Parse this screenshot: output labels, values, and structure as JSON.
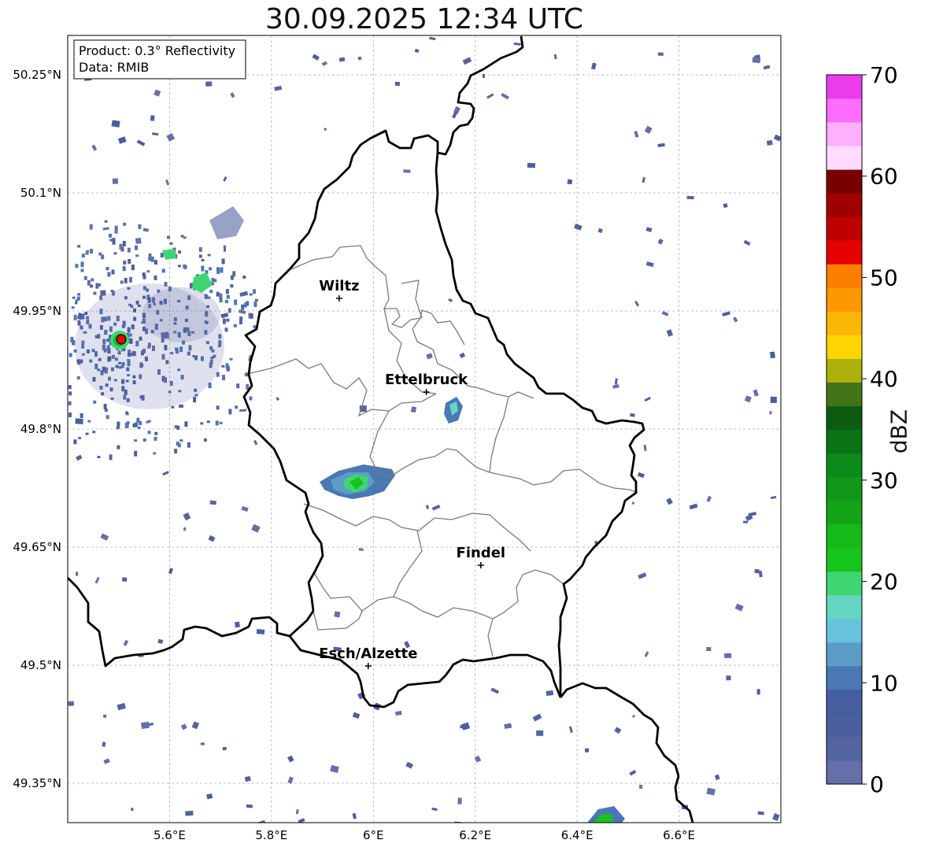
{
  "title": "30.09.2025 12:34 UTC",
  "info_box": {
    "product": "Product: 0.3° Reflectivity",
    "data": "Data: RMIB"
  },
  "map": {
    "lon_ticks": [
      {
        "value": 5.6,
        "label": "5.6°E"
      },
      {
        "value": 5.8,
        "label": "5.8°E"
      },
      {
        "value": 6.0,
        "label": "6°E"
      },
      {
        "value": 6.2,
        "label": "6.2°E"
      },
      {
        "value": 6.4,
        "label": "6.4°E"
      },
      {
        "value": 6.6,
        "label": "6.6°E"
      }
    ],
    "lat_ticks": [
      {
        "value": 50.25,
        "label": "50.25°N"
      },
      {
        "value": 50.1,
        "label": "50.1°N"
      },
      {
        "value": 49.95,
        "label": "49.95°N"
      },
      {
        "value": 49.8,
        "label": "49.8°N"
      },
      {
        "value": 49.65,
        "label": "49.65°N"
      },
      {
        "value": 49.5,
        "label": "49.5°N"
      },
      {
        "value": 49.35,
        "label": "49.35°N"
      }
    ],
    "lon_range": [
      5.4,
      6.8
    ],
    "lat_range": [
      49.3,
      50.3
    ],
    "grid": true,
    "cities": [
      {
        "name": "Wiltz",
        "lon": 5.933,
        "lat": 49.966
      },
      {
        "name": "Ettelbruck",
        "lon": 6.104,
        "lat": 49.847
      },
      {
        "name": "Findel",
        "lon": 6.211,
        "lat": 49.627
      },
      {
        "name": "Esch/Alzette",
        "lon": 5.99,
        "lat": 49.499
      }
    ],
    "radar_site": {
      "lon": 5.505,
      "lat": 49.914
    }
  },
  "colorbar": {
    "label": "dBZ",
    "min": 0,
    "max": 70,
    "tick_values": [
      0,
      10,
      20,
      30,
      40,
      50,
      60,
      70
    ],
    "tick_labels": [
      "0",
      "10",
      "20",
      "30",
      "40",
      "50",
      "60",
      "70"
    ],
    "colors": [
      "#6470a7",
      "#5464a0",
      "#4b5f9f",
      "#455e9f",
      "#4b77b2",
      "#5a9ec8",
      "#67c2dc",
      "#64d6c3",
      "#40d573",
      "#16c41c",
      "#15b91a",
      "#13a515",
      "#11981a",
      "#0c8b1a",
      "#0a7314",
      "#0e5b12",
      "#44741a",
      "#adb00a",
      "#ffd500",
      "#fcb605",
      "#fd9700",
      "#fd7f00",
      "#e60000",
      "#c00000",
      "#a00000",
      "#7a0000",
      "#ffdcfd",
      "#feb0fe",
      "#ff6dff",
      "#eb3ceb"
    ]
  }
}
